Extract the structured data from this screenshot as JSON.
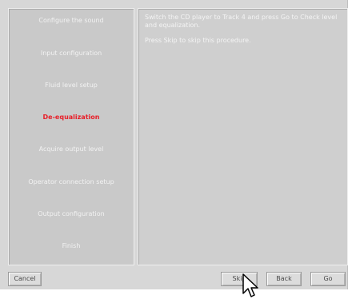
{
  "steps": [
    {
      "label": "Configure the sound"
    },
    {
      "label": "Input configuration"
    },
    {
      "label": "Fluid level setup"
    },
    {
      "label": "De-equalization"
    },
    {
      "label": "Acquire output level"
    },
    {
      "label": "Operator connection setup"
    },
    {
      "label": "Output configuration"
    },
    {
      "label": "Finish"
    }
  ],
  "current_step_index": 3,
  "content": {
    "line1": "Switch the CD player to Track 4 and press Go to Check level and equalization.",
    "line2": "Press Skip to skip this procedure."
  },
  "buttons": {
    "cancel": "Cancel",
    "skip": "Skip",
    "back": "Back",
    "go": "Go"
  },
  "colors": {
    "current_step": "#e8202a",
    "window_bg": "#d7d7d7"
  }
}
